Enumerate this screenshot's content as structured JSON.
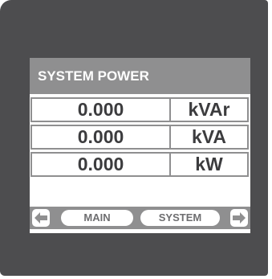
{
  "screen": {
    "title": "SYSTEM POWER",
    "readings": [
      {
        "value": "0.000",
        "unit": "kVAr"
      },
      {
        "value": "0.000",
        "unit": "kVA"
      },
      {
        "value": "0.000",
        "unit": "kW"
      }
    ]
  },
  "nav": {
    "left_icon": "arrow-left-icon",
    "main_label": "MAIN",
    "system_label": "SYSTEM",
    "right_icon": "arrow-right-icon"
  },
  "colors": {
    "bezel": "#4d4d4f",
    "title_bar": "#8f8f90",
    "text": "#3c3c3e"
  }
}
